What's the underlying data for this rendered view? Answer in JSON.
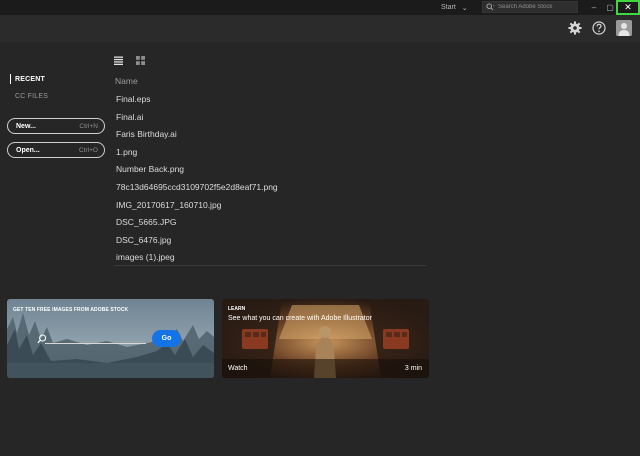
{
  "titlebar": {
    "workspace_label": "Start",
    "workspace_chevron": "⌄",
    "stock_search_placeholder": "Search Adobe Stock",
    "minimize_glyph": "–",
    "maximize_glyph": "▢",
    "close_glyph": "✕",
    "close_highlight": "#3fd93f"
  },
  "header": {
    "settings_icon": "gear-icon",
    "help_icon": "help-icon",
    "avatar_icon": "avatar"
  },
  "sidebar": {
    "items": [
      {
        "label": "RECENT",
        "active": true
      },
      {
        "label": "CC FILES",
        "active": false
      }
    ],
    "new_button": {
      "label": "New...",
      "shortcut": "Ctrl+N"
    },
    "open_button": {
      "label": "Open...",
      "shortcut": "Ctrl+O"
    }
  },
  "files": {
    "view_modes": [
      "list-view-icon",
      "grid-view-icon"
    ],
    "column_header": "Name",
    "rows": [
      "Final.eps",
      "Final.ai",
      "Faris Birthday.ai",
      "1.png",
      "Number Back.png",
      "78c13d64695ccd3109702f5e2d8eaf71.png",
      "IMG_20170617_160710.jpg",
      "DSC_5665.JPG",
      "DSC_6476.jpg",
      "images (1).jpeg"
    ]
  },
  "cards": {
    "stock": {
      "title": "GET TEN FREE IMAGES FROM ADOBE STOCK",
      "go_label": "Go",
      "accent": "#1473e6"
    },
    "learn": {
      "tag": "LEARN",
      "title": "See what you can create with Adobe Illustrator",
      "watch_label": "Watch",
      "duration": "3 min"
    }
  },
  "colors": {
    "background": "#262626",
    "titlebar": "#1b1b1b",
    "header": "#2b2b2b",
    "text": "#dcdcdc",
    "muted_text": "#9c9c9c"
  }
}
